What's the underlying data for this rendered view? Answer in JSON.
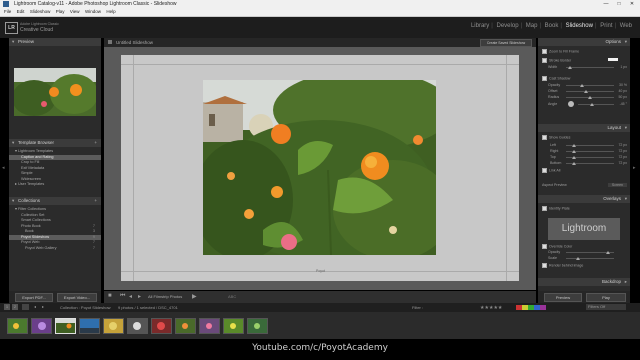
{
  "window": {
    "title": "Lightroom Catalog-v11 - Adobe Photoshop Lightroom Classic - Slideshow",
    "controls": [
      "—",
      "□",
      "✕"
    ]
  },
  "menu": [
    "File",
    "Edit",
    "Slideshow",
    "Play",
    "View",
    "Window",
    "Help"
  ],
  "identity": {
    "badge": "LR",
    "line1": "Adobe Lightroom Classic",
    "line2": "Creative Cloud",
    "modules": [
      "Library",
      "Develop",
      "Map",
      "Book",
      "Slideshow",
      "Print",
      "Web"
    ],
    "active_module": "Slideshow"
  },
  "left_panel": {
    "preview_label": "Preview",
    "template_browser_label": "Template Browser",
    "templates": [
      {
        "label": "▾ Lightroom Templates",
        "selected": false
      },
      {
        "label": "Caption and Rating",
        "selected": true
      },
      {
        "label": "Crop to Fill",
        "selected": false
      },
      {
        "label": "Exif Metadata",
        "selected": false
      },
      {
        "label": "Simple",
        "selected": false
      },
      {
        "label": "Widescreen",
        "selected": false
      },
      {
        "label": "▸ User Templates",
        "selected": false
      }
    ],
    "collections_label": "Collections",
    "collections": [
      {
        "label": "▾ Filter Collections",
        "count": ""
      },
      {
        "label": "Collection Set",
        "count": ""
      },
      {
        "label": "Smart Collections",
        "count": ""
      },
      {
        "label": "Photo Book",
        "count": "7"
      },
      {
        "label": "Book",
        "count": "3"
      },
      {
        "label": "Poyot Slideshow",
        "count": "9",
        "selected": true
      },
      {
        "label": "Poyot Web",
        "count": "7"
      },
      {
        "label": "Poyot Web Gallery",
        "count": "7"
      }
    ],
    "export_pdf": "Export PDF...",
    "export_video": "Export Video..."
  },
  "center": {
    "title": "Untitled Slideshow",
    "create_saved": "Create Saved Slideshow",
    "page_number": "Poyot",
    "toolbar_filter": "All Filmstrip Photos",
    "toolbar_abc": "ABC"
  },
  "right_panel": {
    "options_label": "Options",
    "zoom_to_fill": "Zoom to Fill Frame",
    "stroke_border": "Stroke Border",
    "width_label": "Width",
    "width_value": "1 px",
    "cast_shadow": "Cast Shadow",
    "opacity_label": "Opacity",
    "opacity_value": "30 %",
    "offset_label": "Offset",
    "offset_value": "40 px",
    "radius_label": "Radius",
    "radius_value": "50 px",
    "angle_label": "Angle",
    "angle_value": "-45 °",
    "layout_label": "Layout",
    "show_guides": "Show Guides",
    "left_label": "Left",
    "left_value": "72 px",
    "right_label": "Right",
    "right_value": "72 px",
    "top_label": "Top",
    "top_value": "72 px",
    "bottom_label": "Bottom",
    "bottom_value": "72 px",
    "link_all": "Link All",
    "aspect_label": "Aspect Preview",
    "aspect_value": "Screen",
    "overlays_label": "Overlays",
    "identity_plate": "Identity Plate",
    "watermark_text": "Lightroom",
    "override_color": "Override Color",
    "opacity2_label": "Opacity",
    "scale_label": "Scale",
    "render_behind": "Render behind image",
    "backdrop_label": "Backdrop",
    "preview_button": "Preview",
    "play_button": "Play"
  },
  "filmstrip": {
    "page_indicators": [
      "1",
      "2"
    ],
    "source": "Collection : Poyot Slideshow",
    "count_text": "9 photos / 1 selected / DSC_4701",
    "filter_label": "Filter :",
    "filter_value": "Filters Off",
    "thumb_count": 11,
    "selected_index": 2
  },
  "footer": {
    "url": "Youtube.com/c/PoyotAcademy"
  },
  "colors": {
    "panel": "#2b2b2b",
    "header": "#3b3b3b",
    "stage": "#5a5a5a",
    "slide_bg": "#c8c8c8",
    "accent_text": "#e6e6e6"
  }
}
